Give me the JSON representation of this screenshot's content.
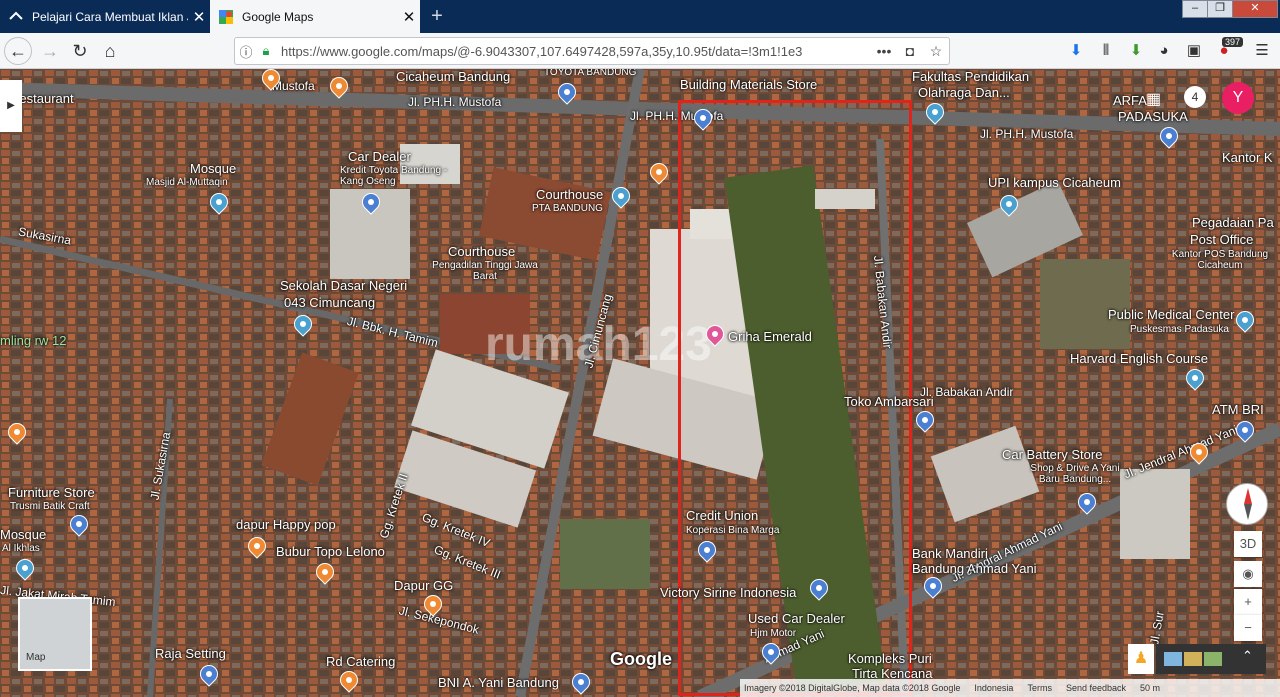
{
  "browser": {
    "tabs": [
      {
        "title": "Pelajari Cara Membuat Iklan Ju",
        "close": "✕"
      },
      {
        "title": "Google Maps",
        "close": "✕"
      }
    ],
    "new_tab": "+",
    "url": "https://www.google.com/maps/@-6.9043307,107.6497428,597a,35y,10.95t/data=!3m1!1e3",
    "badge_count": "397"
  },
  "map": {
    "places": [
      {
        "name": "Restaurant",
        "sub": ""
      },
      {
        "name": "Cicaheum Bandung",
        "sub": "TOYOTA BANDUNG"
      },
      {
        "name": "Building Materials Store",
        "sub": ""
      },
      {
        "name": "Fakultas Pendidikan",
        "sub": "Olahraga Dan..."
      },
      {
        "name": "ARFA",
        "sub": "PADASUKA"
      },
      {
        "name": "Kantor K",
        "sub": ""
      },
      {
        "name": "Mosque",
        "sub": "Masjid Al-Muttaqin"
      },
      {
        "name": "Car Dealer",
        "sub": "Kredit Toyota Bandung - Kang Oseng"
      },
      {
        "name": "Courthouse",
        "sub": "PTA BANDUNG"
      },
      {
        "name": "UPI kampus Cicaheum",
        "sub": ""
      },
      {
        "name": "Pegadaian Pa",
        "sub": ""
      },
      {
        "name": "Post Office",
        "sub": "Kantor POS Bandung Cicaheum"
      },
      {
        "name": "Courthouse",
        "sub": "Pengadilan Tinggi Jawa Barat"
      },
      {
        "name": "Sekolah Dasar Negeri",
        "sub": "043 Cimuncang"
      },
      {
        "name": "Griha Emerald",
        "sub": ""
      },
      {
        "name": "Public Medical Center",
        "sub": "Puskesmas Padasuka"
      },
      {
        "name": "Harvard English Course",
        "sub": ""
      },
      {
        "name": "Toko Ambarsari",
        "sub": ""
      },
      {
        "name": "ATM BRI",
        "sub": ""
      },
      {
        "name": "Car Battery Store",
        "sub": "Shop & Drive A Yani Baru Bandung..."
      },
      {
        "name": "Furniture Store",
        "sub": "Trusmi Batik Craft"
      },
      {
        "name": "Mosque",
        "sub": "Al Ikhlas"
      },
      {
        "name": "dapur Happy pop",
        "sub": ""
      },
      {
        "name": "Credit Union",
        "sub": "Koperasi Bina Marga"
      },
      {
        "name": "Bubur Topo Lelono",
        "sub": ""
      },
      {
        "name": "Dapur GG",
        "sub": ""
      },
      {
        "name": "Victory Sirine Indonesia",
        "sub": ""
      },
      {
        "name": "Bank Mandiri",
        "sub": "Bandung Ahmad Yani"
      },
      {
        "name": "Used Car Dealer",
        "sub": "Hjm Motor"
      },
      {
        "name": "Raja Setting",
        "sub": ""
      },
      {
        "name": "Rd Catering",
        "sub": ""
      },
      {
        "name": "Kompleks Puri",
        "sub": "Tirta Kencana"
      },
      {
        "name": "BNI A. Yani Bandung",
        "sub": ""
      },
      {
        "name": "mling rw 12",
        "sub": ""
      }
    ],
    "roads": [
      "Jl. PH.H. Mustofa",
      "Jl. PH.H. Mustofa",
      "Jl. PH.H. Mustofa",
      "Sukasirna",
      "Jl. Bbk. H. Tamim",
      "Jl. Cimuncang",
      "Jl. Babakan Andir",
      "Jl. Babakan Andir",
      "Jl. Sukasirna",
      "Gg. Kretek II",
      "Gg. Kretek IV",
      "Gg. Kretek III",
      "Jl. Sekepondok",
      "Jl. Jendral Ahmad Yani",
      "Jl. Jendral Ahmad Yani",
      "Jl. Sur",
      "Ahmad Yani",
      "Jl. Jakat Mirah Tamim",
      "Mustofa"
    ],
    "watermark": "rumah123",
    "google_logo": "Google",
    "minimap_label": "Map",
    "controls": {
      "view3d": "3D",
      "zoom_in": "+",
      "zoom_out": "−",
      "notifications": "4",
      "avatar": "Y"
    },
    "attribution": [
      "Imagery ©2018 DigitalGlobe, Map data ©2018 Google",
      "Indonesia",
      "Terms",
      "Send feedback",
      "50 m"
    ]
  }
}
